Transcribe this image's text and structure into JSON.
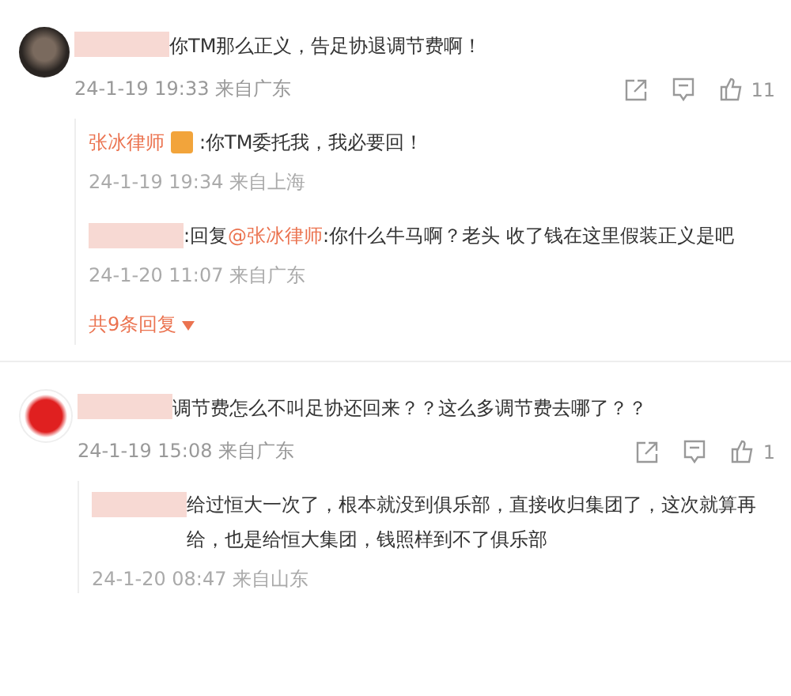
{
  "comments": [
    {
      "text": "你TM那么正义，告足协退调节费啊！",
      "time": "24-1-19 19:33 来自广东",
      "likes": "11",
      "replies": [
        {
          "author": "张冰律师",
          "badge": true,
          "text": ":你TM委托我，我必要回！",
          "time": "24-1-19 19:34 来自上海"
        },
        {
          "badge": false,
          "prefix": ":回复",
          "mention": "@张冰律师",
          "text": ":你什么牛马啊？老头  收了钱在这里假装正义是吧",
          "time": "24-1-20 11:07 来自广东"
        }
      ],
      "more_replies": "共9条回复"
    },
    {
      "text": "调节费怎么不叫足协还回来？？这么多调节费去哪了？？",
      "time": "24-1-19 15:08 来自广东",
      "likes": "1",
      "replies": [
        {
          "badge": false,
          "text": "给过恒大一次了，根本就没到俱乐部，直接收归集团了，这次就算再给，也是给恒大集团，钱照样到不了俱乐部",
          "time": "24-1-20 08:47 来自山东"
        }
      ]
    }
  ]
}
